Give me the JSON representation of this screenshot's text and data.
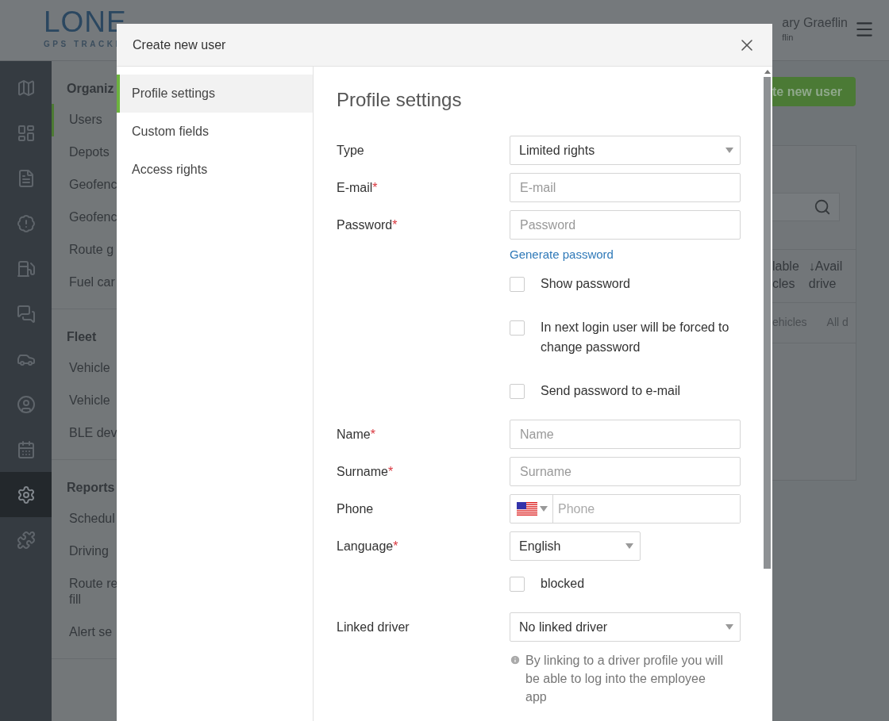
{
  "header": {
    "logo": "LONE",
    "tagline": "GPS TRACKI",
    "user_name": "ary Graeflin",
    "user_sub": "flin"
  },
  "rail": [
    {
      "selected": false
    },
    {
      "selected": false
    },
    {
      "selected": false
    },
    {
      "selected": false
    },
    {
      "selected": false
    },
    {
      "selected": false
    },
    {
      "selected": false
    },
    {
      "selected": false
    },
    {
      "selected": false
    },
    {
      "selected": true
    },
    {
      "selected": false
    }
  ],
  "nav": [
    {
      "title": "Organiz",
      "items": [
        {
          "label": "Users",
          "selected": true
        },
        {
          "label": "Depots",
          "selected": false
        },
        {
          "label": "Geofenc",
          "selected": false
        },
        {
          "label": "Geofenc",
          "selected": false
        },
        {
          "label": "Route g",
          "selected": false
        },
        {
          "label": "Fuel car",
          "selected": false
        }
      ]
    },
    {
      "title": "Fleet",
      "items": [
        {
          "label": "Vehicle",
          "selected": false
        },
        {
          "label": "Vehicle",
          "selected": false
        },
        {
          "label": "BLE dev",
          "selected": false
        }
      ]
    },
    {
      "title": "Reports",
      "items": [
        {
          "label": "Schedul",
          "selected": false
        },
        {
          "label": "Driving",
          "selected": false
        },
        {
          "label": "Route re\nfill",
          "selected": false
        },
        {
          "label": "Alert se",
          "selected": false
        }
      ]
    }
  ],
  "content": {
    "create_button": "te new user",
    "columns": [
      {
        "text": "lable\ncles"
      },
      {
        "text": "Avail\ndrive",
        "sort_mark": "↓"
      }
    ],
    "filters": [
      "ehicles",
      "All d"
    ]
  },
  "dialog": {
    "title": "Create new user",
    "tabs": [
      {
        "label": "Profile settings",
        "selected": true
      },
      {
        "label": "Custom fields",
        "selected": false
      },
      {
        "label": "Access rights",
        "selected": false
      }
    ],
    "heading": "Profile settings",
    "fields": [
      {
        "kind": "select",
        "label": "Type",
        "value": "Limited rights"
      },
      {
        "kind": "input",
        "label": "E-mail",
        "required_mark": "*",
        "placeholder": "E-mail"
      },
      {
        "kind": "input",
        "label": "Password",
        "required_mark": "*",
        "placeholder": "Password"
      },
      {
        "kind": "link",
        "text": "Generate password"
      },
      {
        "kind": "checkbox",
        "text": "Show password",
        "checked": false
      },
      {
        "kind": "checkbox",
        "text": "In next login user will be forced to change password",
        "checked": false
      },
      {
        "kind": "checkbox",
        "text": "Send password to e-mail",
        "checked": false
      },
      {
        "kind": "input",
        "label": "Name",
        "required_mark": "*",
        "placeholder": "Name"
      },
      {
        "kind": "input",
        "label": "Surname",
        "required_mark": "*",
        "placeholder": "Surname"
      },
      {
        "kind": "phone",
        "label": "Phone",
        "placeholder": "Phone"
      },
      {
        "kind": "select",
        "label": "Language",
        "required_mark": "*",
        "value": "English",
        "compact": true
      },
      {
        "kind": "checkbox",
        "text": "blocked",
        "checked": false
      },
      {
        "kind": "select",
        "label": "Linked driver",
        "value": "No linked driver"
      },
      {
        "kind": "note",
        "text": "By linking to a driver profile you will be able to log into the employee app"
      }
    ]
  }
}
